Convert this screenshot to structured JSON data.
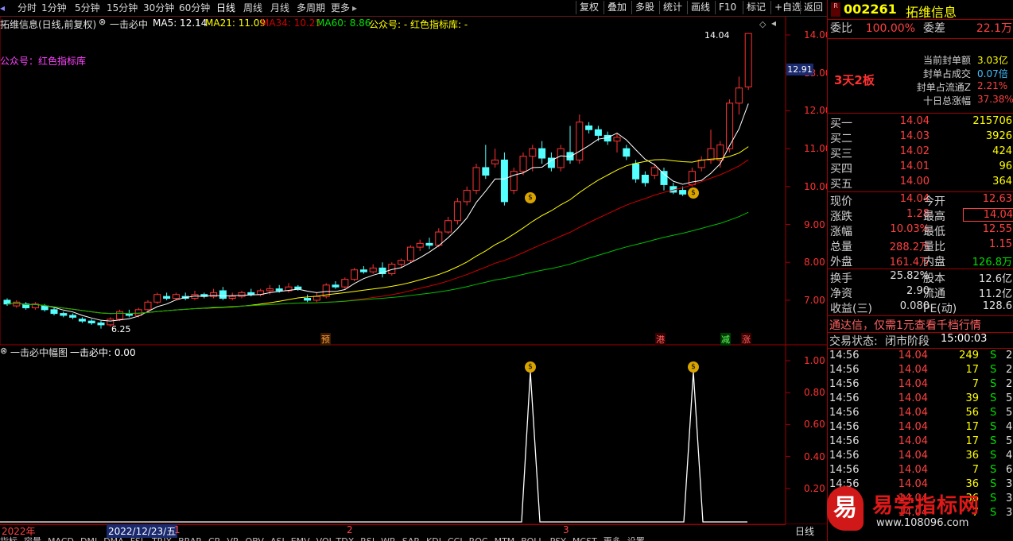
{
  "toolbar": {
    "periods": [
      "分时",
      "1分钟",
      "5分钟",
      "15分钟",
      "30分钟",
      "60分钟",
      "日线",
      "周线",
      "月线",
      "多周期",
      "更多"
    ],
    "more_arrow": "▸",
    "actions": [
      "复权",
      "叠加",
      "多股",
      "统计",
      "画线",
      "F10",
      "标记",
      "+自选",
      "返回"
    ]
  },
  "main_info": {
    "stock_title": "拓维信息(日线,前复权)",
    "indicator_name": "一击必中",
    "ma5": "MA5: 12.14",
    "ma21": "MA21: 11.09",
    "ma34": "MA34: 10.25",
    "ma60": "MA60: 8.86",
    "gzh": "公众号: - 红色指标库: -",
    "watermark_text": "公众号：红色指标库",
    "high_label": "14.04",
    "low_label": "6.25",
    "current_price_tag": "12.91"
  },
  "price_axis": [
    "14.00",
    "13.00",
    "12.00",
    "11.00",
    "10.00",
    "9.00",
    "8.00",
    "7.00"
  ],
  "sub_info": {
    "title": "一击必中幅图",
    "value": "一击必中: 0.00"
  },
  "sub_axis": [
    "1.00",
    "0.80",
    "0.60",
    "0.40",
    "0.20"
  ],
  "markers": {
    "yu": "预",
    "gang": "港",
    "jian": "减",
    "zhang": "涨"
  },
  "timeline": {
    "year": "2022年",
    "cursor_date": "2022/12/23/五",
    "months": [
      "1",
      "2",
      "3"
    ],
    "period_label": "日线"
  },
  "bottom_tabs": [
    "指标",
    "容量",
    "MACD",
    "DMI",
    "DMA",
    "FSL",
    "TRIX",
    "BRAR",
    "CR",
    "VR",
    "OBV",
    "ASI",
    "EMV",
    "VOL-TDX",
    "RSI",
    "WR",
    "SAR",
    "KDJ",
    "CCI",
    "ROC",
    "MTM",
    "BOLL",
    "PSY",
    "MCST",
    "更多",
    "设置"
  ],
  "panel": {
    "code": "002261",
    "name": "拓维信息",
    "r_badge": "R",
    "weibi_label": "委比",
    "weibi_value": "100.00%",
    "weicha_label": "委差",
    "weicha_value": "22.1万",
    "board_tag": "3天2板",
    "seal_stats": [
      {
        "label": "当前封单额",
        "value": "3.03亿"
      },
      {
        "label": "封单占成交",
        "value": "0.07倍"
      },
      {
        "label": "封单占流通Z",
        "value": "2.21%"
      },
      {
        "label": "十日总涨幅",
        "value": "37.38%"
      }
    ],
    "bids": [
      {
        "label": "买一",
        "price": "14.04",
        "vol": "215706"
      },
      {
        "label": "买二",
        "price": "14.03",
        "vol": "3926"
      },
      {
        "label": "买三",
        "price": "14.02",
        "vol": "424"
      },
      {
        "label": "买四",
        "price": "14.01",
        "vol": "96"
      },
      {
        "label": "买五",
        "price": "14.00",
        "vol": "364"
      }
    ],
    "quote": [
      {
        "l1": "现价",
        "v1": "14.04",
        "l2": "今开",
        "v2": "12.63",
        "c2": "#ff4040"
      },
      {
        "l1": "涨跌",
        "v1": "1.28",
        "l2": "最高",
        "v2": "14.04",
        "c2": "#ff4040"
      },
      {
        "l1": "涨幅",
        "v1": "10.03%",
        "l2": "最低",
        "v2": "12.55",
        "c2": "#ff4040"
      },
      {
        "l1": "总量",
        "v1": "288.2万",
        "l2": "量比",
        "v2": "1.15",
        "c2": "#ff4040"
      },
      {
        "l1": "外盘",
        "v1": "161.4万",
        "l2": "内盘",
        "v2": "126.8万",
        "c2": "#00e000"
      }
    ],
    "fund": [
      {
        "l1": "换手",
        "v1": "25.82%",
        "l2": "股本",
        "v2": "12.6亿"
      },
      {
        "l1": "净资",
        "v1": "2.90",
        "l2": "流通",
        "v2": "11.2亿"
      },
      {
        "l1": "收益(三)",
        "v1": "0.080",
        "l2": "PE(动)",
        "v2": "128.6"
      }
    ],
    "ad": "通达信，仅需1元查看千档行情",
    "status_label": "交易状态:",
    "status_value": "闭市阶段",
    "status_time": "15:00:03",
    "ticks": [
      {
        "t": "14:56",
        "p": "14.04",
        "v": "249",
        "s": "S",
        "n": "2"
      },
      {
        "t": "14:56",
        "p": "14.04",
        "v": "17",
        "s": "S",
        "n": "2"
      },
      {
        "t": "14:56",
        "p": "14.04",
        "v": "7",
        "s": "S",
        "n": "2"
      },
      {
        "t": "14:56",
        "p": "14.04",
        "v": "39",
        "s": "S",
        "n": "5"
      },
      {
        "t": "14:56",
        "p": "14.04",
        "v": "56",
        "s": "S",
        "n": "5"
      },
      {
        "t": "14:56",
        "p": "14.04",
        "v": "17",
        "s": "S",
        "n": "4"
      },
      {
        "t": "14:56",
        "p": "14.04",
        "v": "17",
        "s": "S",
        "n": "5"
      },
      {
        "t": "14:56",
        "p": "14.04",
        "v": "36",
        "s": "S",
        "n": "4"
      },
      {
        "t": "14:56",
        "p": "14.04",
        "v": "7",
        "s": "S",
        "n": "6"
      },
      {
        "t": "14:56",
        "p": "14.04",
        "v": "36",
        "s": "S",
        "n": "3"
      },
      {
        "t": "14:56",
        "p": "14.04",
        "v": "36",
        "s": "S",
        "n": "3"
      },
      {
        "t": "14:56",
        "p": "14.04",
        "v": "7",
        "s": "S",
        "n": "3"
      }
    ]
  },
  "watermark": {
    "char": "易",
    "text": "易学指标网",
    "url": "www.108096.com"
  },
  "colors": {
    "up": "#ff3232",
    "down": "#54ffff",
    "ma5": "#ffffff",
    "ma21": "#ffff00",
    "ma34": "#d00000",
    "ma60": "#00c000",
    "grid_border": "#a00000"
  }
}
